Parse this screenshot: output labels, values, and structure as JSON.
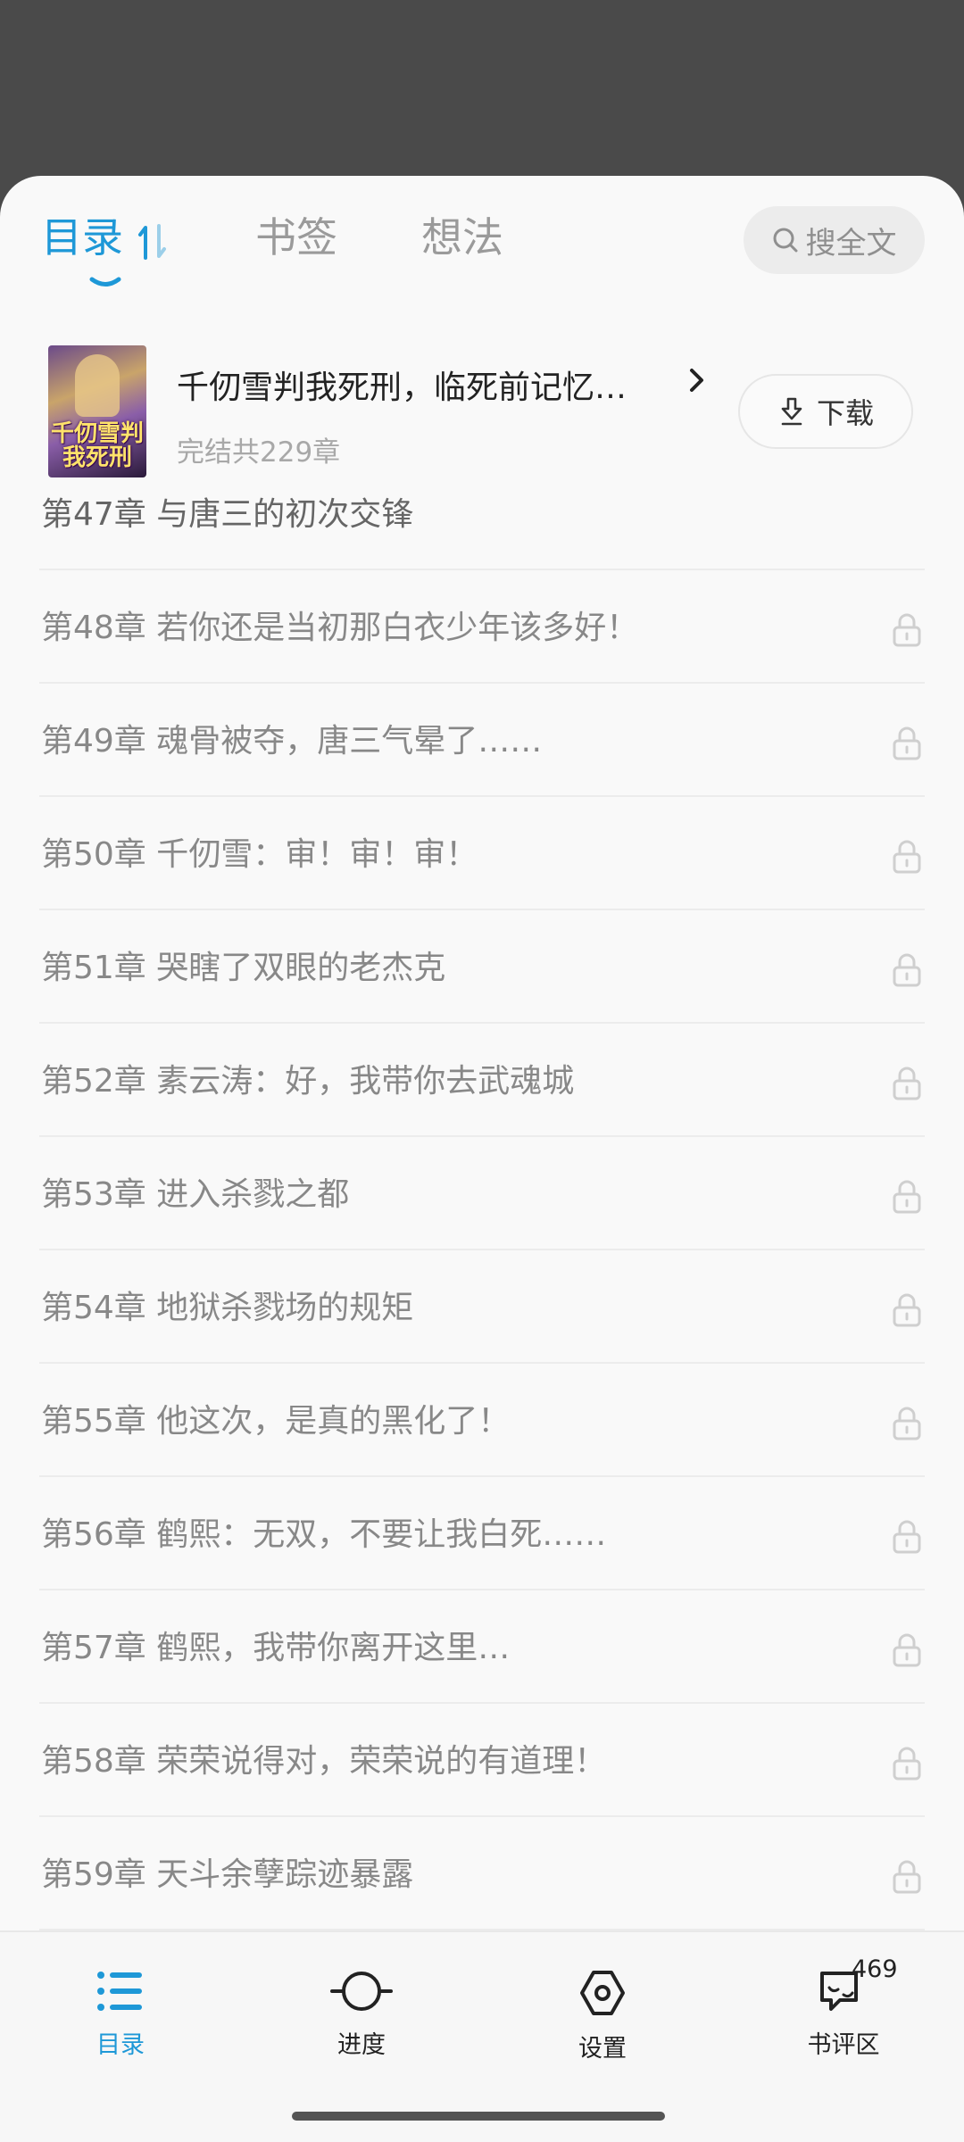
{
  "tabs": {
    "toc": "目录",
    "bookmarks": "书签",
    "thoughts": "想法",
    "search": "搜全文"
  },
  "book": {
    "cover_text": "千仞雪判我死刑",
    "title": "千仞雪判我死刑，临死前记忆…",
    "meta": "完结共229章",
    "download": "下载"
  },
  "chapters": [
    {
      "title": "第47章 与唐三的初次交锋",
      "locked": false
    },
    {
      "title": "第48章 若你还是当初那白衣少年该多好！",
      "locked": true
    },
    {
      "title": "第49章 魂骨被夺，唐三气晕了……",
      "locked": true
    },
    {
      "title": "第50章 千仞雪：审！审！审！",
      "locked": true
    },
    {
      "title": "第51章 哭瞎了双眼的老杰克",
      "locked": true
    },
    {
      "title": "第52章 素云涛：好，我带你去武魂城",
      "locked": true
    },
    {
      "title": "第53章 进入杀戮之都",
      "locked": true
    },
    {
      "title": "第54章 地狱杀戮场的规矩",
      "locked": true
    },
    {
      "title": "第55章 他这次，是真的黑化了！",
      "locked": true
    },
    {
      "title": "第56章 鹤熙：无双，不要让我白死……",
      "locked": true
    },
    {
      "title": "第57章 鹤熙，我带你离开这里…",
      "locked": true
    },
    {
      "title": "第58章 荣荣说得对，荣荣说的有道理！",
      "locked": true
    },
    {
      "title": "第59章 天斗余孽踪迹暴露",
      "locked": true
    }
  ],
  "bottom_nav": {
    "toc": "目录",
    "progress": "进度",
    "settings": "设置",
    "reviews": "书评区",
    "reviews_count": "469"
  },
  "colors": {
    "accent": "#1e98d7",
    "overlay": "#4a4a4a",
    "sheet": "#f9f9f9"
  },
  "icons": [
    "sort-icon",
    "search-icon",
    "chevron-right-icon",
    "download-icon",
    "lock-icon",
    "list-icon",
    "progress-icon",
    "settings-icon",
    "review-icon"
  ]
}
